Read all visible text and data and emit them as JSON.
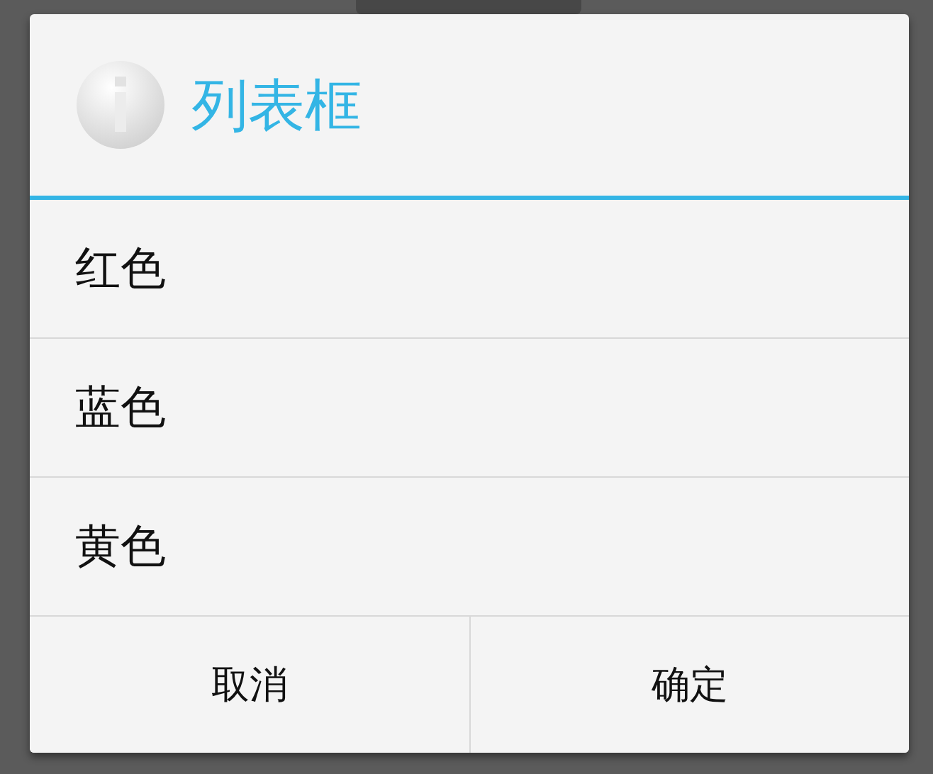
{
  "dialog": {
    "title": "列表框",
    "items": [
      {
        "label": "红色"
      },
      {
        "label": "蓝色"
      },
      {
        "label": "黄色"
      }
    ],
    "buttons": [
      {
        "label": "取消"
      },
      {
        "label": "确定"
      }
    ]
  }
}
